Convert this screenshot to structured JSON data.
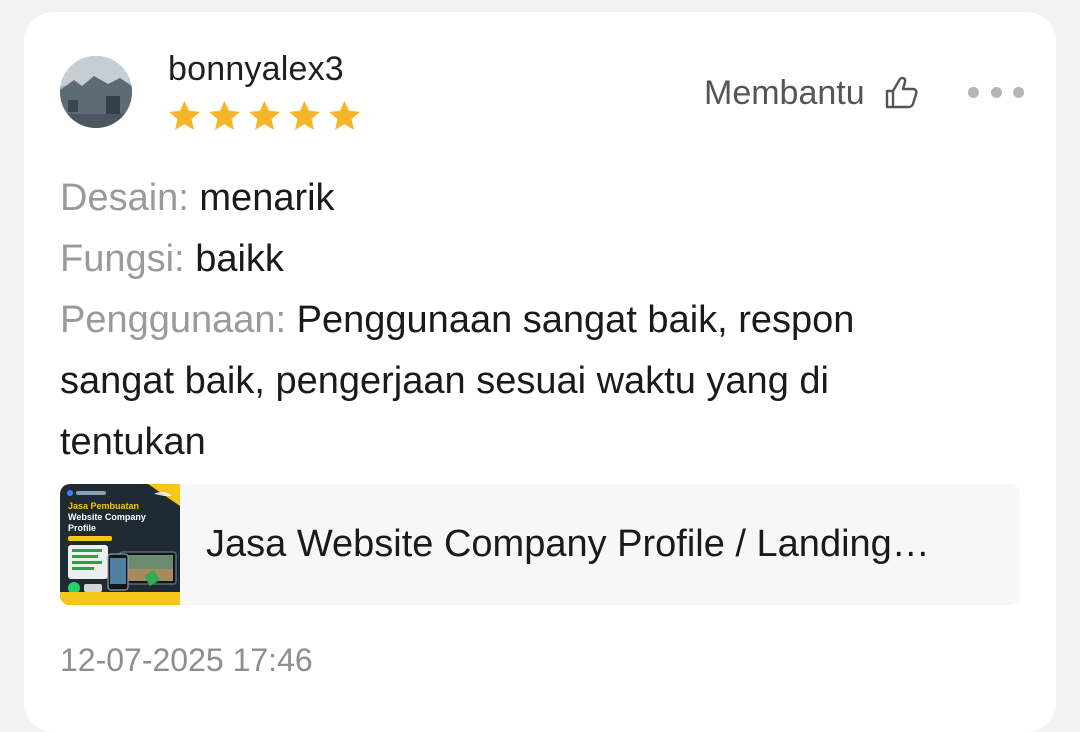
{
  "review": {
    "username": "bonnyalex3",
    "rating": 5,
    "rating_max": 5,
    "helpful_label": "Membantu",
    "attributes": [
      {
        "key": "Desain:",
        "value": "menarik"
      },
      {
        "key": "Fungsi:",
        "value": "baikk"
      },
      {
        "key": "Penggunaan:",
        "value": "Penggunaan sangat baik, respon sangat baik, pengerjaan sesuai waktu yang di tentukan"
      }
    ],
    "timestamp": "12-07-2025 17:46"
  },
  "product": {
    "title": "Jasa Website Company Profile / Landing…",
    "thumbnail_text": {
      "line1": "Jasa Pembuatan",
      "line2": "Website Company",
      "line3": "Profile"
    }
  },
  "icons": {
    "star": "star-icon",
    "helpful": "thumbs-up-icon",
    "more": "more-horizontal-icon"
  },
  "colors": {
    "star": "#f7b529",
    "muted_label": "#9a9a9a",
    "text": "#1a1a1a",
    "thumbnail_bg": "#1f2a33",
    "thumbnail_accent": "#f5c518"
  }
}
